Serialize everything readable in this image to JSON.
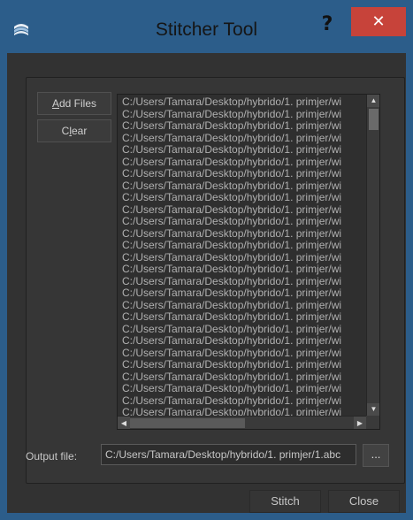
{
  "window": {
    "title": "Stitcher Tool",
    "help_label": "?",
    "close_label": "✕"
  },
  "buttons": {
    "add_files": {
      "accel": "A",
      "rest": "dd Files"
    },
    "clear": {
      "before": "C",
      "accel": "l",
      "rest": "ear"
    },
    "stitch": "Stitch",
    "close": "Close",
    "browse": "..."
  },
  "file_list": {
    "items": [
      "C:/Users/Tamara/Desktop/hybrido/1. primjer/wi",
      "C:/Users/Tamara/Desktop/hybrido/1. primjer/wi",
      "C:/Users/Tamara/Desktop/hybrido/1. primjer/wi",
      "C:/Users/Tamara/Desktop/hybrido/1. primjer/wi",
      "C:/Users/Tamara/Desktop/hybrido/1. primjer/wi",
      "C:/Users/Tamara/Desktop/hybrido/1. primjer/wi",
      "C:/Users/Tamara/Desktop/hybrido/1. primjer/wi",
      "C:/Users/Tamara/Desktop/hybrido/1. primjer/wi",
      "C:/Users/Tamara/Desktop/hybrido/1. primjer/wi",
      "C:/Users/Tamara/Desktop/hybrido/1. primjer/wi",
      "C:/Users/Tamara/Desktop/hybrido/1. primjer/wi",
      "C:/Users/Tamara/Desktop/hybrido/1. primjer/wi",
      "C:/Users/Tamara/Desktop/hybrido/1. primjer/wi",
      "C:/Users/Tamara/Desktop/hybrido/1. primjer/wi",
      "C:/Users/Tamara/Desktop/hybrido/1. primjer/wi",
      "C:/Users/Tamara/Desktop/hybrido/1. primjer/wi",
      "C:/Users/Tamara/Desktop/hybrido/1. primjer/wi",
      "C:/Users/Tamara/Desktop/hybrido/1. primjer/wi",
      "C:/Users/Tamara/Desktop/hybrido/1. primjer/wi",
      "C:/Users/Tamara/Desktop/hybrido/1. primjer/wi",
      "C:/Users/Tamara/Desktop/hybrido/1. primjer/wi",
      "C:/Users/Tamara/Desktop/hybrido/1. primjer/wi",
      "C:/Users/Tamara/Desktop/hybrido/1. primjer/wi",
      "C:/Users/Tamara/Desktop/hybrido/1. primjer/wi",
      "C:/Users/Tamara/Desktop/hybrido/1. primjer/wi",
      "C:/Users/Tamara/Desktop/hybrido/1. primjer/wi",
      "C:/Users/Tamara/Desktop/hybrido/1. primjer/wi"
    ],
    "scroll_up_icon": "triangle-up-icon",
    "scroll_down_icon": "triangle-down-icon",
    "scroll_left_icon": "triangle-left-icon",
    "scroll_right_icon": "triangle-right-icon"
  },
  "output": {
    "label": "Output file:",
    "value": "C:/Users/Tamara/Desktop/hybrido/1. primjer/1.abc"
  },
  "colors": {
    "titlebar": "#2c5d8a",
    "close_button": "#c7433a",
    "panel": "#323232"
  }
}
